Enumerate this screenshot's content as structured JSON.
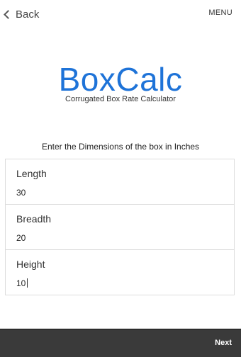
{
  "header": {
    "back_label": "Back",
    "menu_label": "MENU"
  },
  "brand": {
    "title": "BoxCalc",
    "subtitle": "Corrugated Box Rate Calculator",
    "accent_color": "#1e73d8"
  },
  "form": {
    "instruction": "Enter the Dimensions of the box in Inches",
    "fields": [
      {
        "label": "Length",
        "value": "30"
      },
      {
        "label": "Breadth",
        "value": "20"
      },
      {
        "label": "Height",
        "value": "10"
      }
    ]
  },
  "footer": {
    "next_label": "Next"
  },
  "icons": {
    "back": "chevron-left-icon"
  }
}
